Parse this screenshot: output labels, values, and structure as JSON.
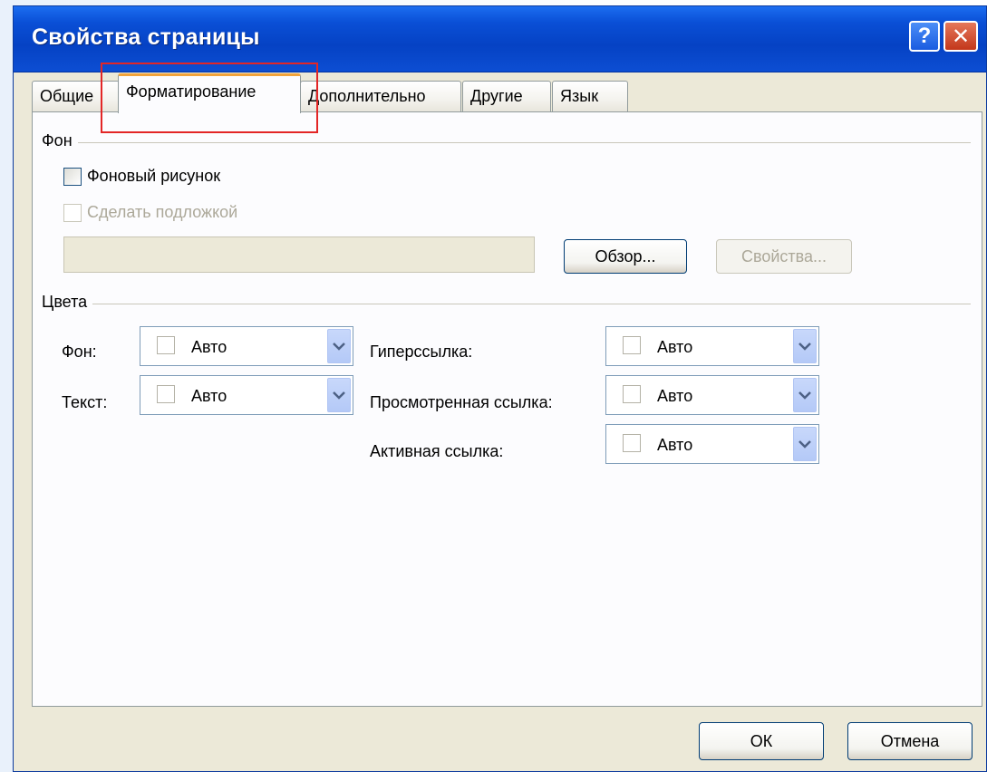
{
  "window": {
    "title": "Свойства страницы",
    "help_glyph": "?",
    "close_glyph": "✕"
  },
  "tabs": [
    {
      "label": "Общие",
      "active": false
    },
    {
      "label": "Форматирование",
      "active": true
    },
    {
      "label": "Дополнительно",
      "active": false
    },
    {
      "label": "Другие",
      "active": false
    },
    {
      "label": "Язык",
      "active": false
    }
  ],
  "background_group": {
    "label": "Фон",
    "background_image_checkbox": {
      "label": "Фоновый рисунок",
      "checked": false
    },
    "watermark_checkbox": {
      "label": "Сделать подложкой",
      "checked": false,
      "enabled": false
    },
    "image_path_value": "",
    "browse_button": "Обзор...",
    "properties_button": "Свойства..."
  },
  "colors_group": {
    "label": "Цвета",
    "background": {
      "label": "Фон:",
      "value": "Авто"
    },
    "text": {
      "label": "Текст:",
      "value": "Авто"
    },
    "hyperlink": {
      "label": "Гиперссылка:",
      "value": "Авто"
    },
    "visited_link": {
      "label": "Просмотренная ссылка:",
      "value": "Авто"
    },
    "active_link": {
      "label": "Активная ссылка:",
      "value": "Авто"
    }
  },
  "footer": {
    "ok": "ОК",
    "cancel": "Отмена"
  },
  "colors": {
    "titlebar": "#0542c4",
    "dialog_bg": "#ece9d8",
    "active_tab_accent": "#f1a33b",
    "highlight_box": "#e32626"
  },
  "icons": {
    "help": "help-icon",
    "close": "close-icon",
    "dropdown": "chevron-down-icon"
  }
}
